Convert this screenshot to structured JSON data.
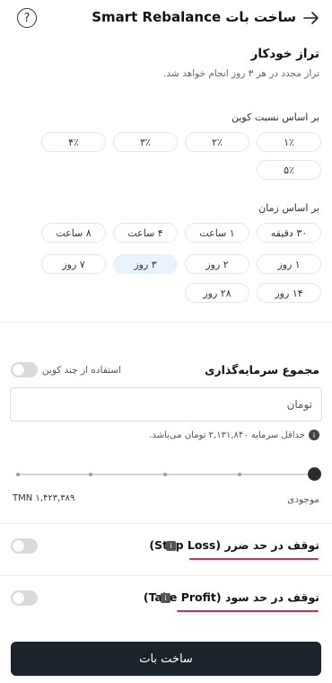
{
  "header": {
    "title": "ساخت بات Smart Rebalance",
    "back_icon": "arrow-right-icon",
    "help_icon": "question-circle-icon",
    "help_glyph": "?"
  },
  "auto_rebalance": {
    "title": "تراز خودکار",
    "description": "تراز مجدد در هر ۳ روز انجام خواهد شد."
  },
  "ratio": {
    "label": "بر اساس نسبت کوین",
    "options": [
      "۱٪",
      "۲٪",
      "۳٪",
      "۴٪",
      "۵٪"
    ]
  },
  "time": {
    "label": "بر اساس زمان",
    "options": [
      "۳۰ دقیقه",
      "۱ ساعت",
      "۴ ساعت",
      "۸ ساعت",
      "۱ روز",
      "۲ روز",
      "۳ روز",
      "۷ روز",
      "۱۴ روز",
      "۲۸ روز"
    ],
    "selected": "۳ روز"
  },
  "investment": {
    "title": "مجموع سرمایه‌گذاری",
    "multi_coin_label": "استفاده از چند کوین",
    "multi_coin_enabled": false,
    "input_placeholder": "تومان",
    "min_note": "حداقل سرمایه ۲,۱۳۱,۸۴۰ تومان می‌باشد.",
    "info_glyph": "i",
    "balance_label": "موجودی",
    "balance_value": "TMN ۱,۴۲۳,۳۸۹",
    "slider_percent": 100
  },
  "stop_loss": {
    "title": "توقف در حد ضرر (Stop Loss)",
    "enabled": false,
    "info_glyph": "i"
  },
  "take_profit": {
    "title": "توقف در حد سود (Take Profit)",
    "enabled": false,
    "info_glyph": "i"
  },
  "submit": {
    "label": "ساخت بات"
  },
  "colors": {
    "primary_button": "#1d232c",
    "selected_option": "#e8f3fe",
    "underline_accent": "#e0294a"
  }
}
